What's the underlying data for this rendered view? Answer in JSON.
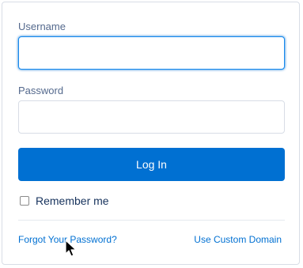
{
  "form": {
    "username_label": "Username",
    "username_value": "",
    "username_placeholder": "",
    "password_label": "Password",
    "password_value": "",
    "password_placeholder": "",
    "login_label": "Log In",
    "remember_label": "Remember me",
    "remember_checked": false
  },
  "links": {
    "forgot_password": "Forgot Your Password?",
    "custom_domain": "Use Custom Domain"
  },
  "colors": {
    "accent": "#0070d2",
    "focus_border": "#1589ee",
    "label": "#54698d",
    "text": "#16325c",
    "border": "#d8dde6"
  },
  "icons": {
    "pointer": "arrow-pointer-icon"
  }
}
